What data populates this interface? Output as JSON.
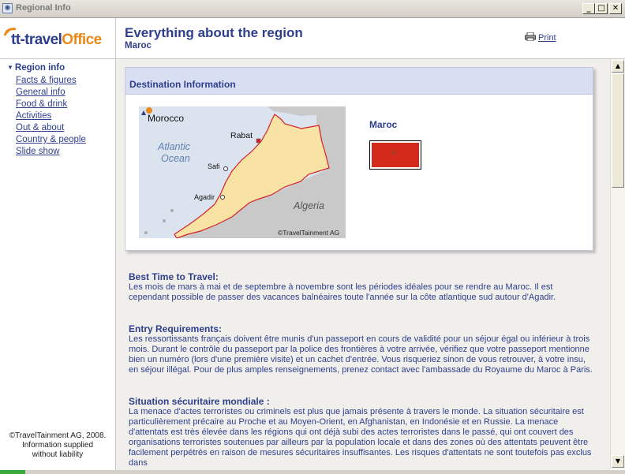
{
  "window": {
    "title": "Regional Info",
    "app_icon": "globe-window-icon",
    "controls": {
      "minimize": "minimize-icon",
      "maximize": "maximize-icon",
      "close": "close-icon"
    }
  },
  "sidebar": {
    "logo": {
      "prefix": "tt-travel",
      "suffix": "Office"
    },
    "section_title": "Region info",
    "items": [
      {
        "label": "Facts & figures"
      },
      {
        "label": "General info"
      },
      {
        "label": "Food & drink"
      },
      {
        "label": "Activities"
      },
      {
        "label": "Out & about"
      },
      {
        "label": "Country & people"
      },
      {
        "label": "Slide show"
      }
    ],
    "footer": [
      "©TravelTainment AG, 2008.",
      "Information supplied",
      "without liability"
    ]
  },
  "header": {
    "title": "Everything about the region",
    "subtitle": "Maroc",
    "print_label": "Print",
    "print_icon": "printer-icon"
  },
  "destination": {
    "heading": "Destination Information",
    "country": "Maroc",
    "flag_colors": {
      "field": "#d42a1c",
      "star": "#0a7a3a"
    },
    "map": {
      "title": "Morocco",
      "ocean": [
        "Atlantic",
        "Ocean"
      ],
      "cities": [
        "Rabat",
        "Safi",
        "Agadir"
      ],
      "neighbor": "Algeria",
      "credit": "©TravelTainment AG",
      "colors": {
        "sea": "#dbe4ee",
        "land": "#f9e3a4",
        "neighbor": "#c9c9c9",
        "border": "#d4202a"
      }
    }
  },
  "sections": [
    {
      "heading": "Best Time to Travel:",
      "text": "Les mois de mars à mai et de septembre à novembre sont les périodes idéales pour se rendre au Maroc. Il est cependant possible de passer des vacances balnéaires toute l'année sur la côte atlantique sud autour d'Agadir."
    },
    {
      "heading": "Entry Requirements:",
      "text": "Les ressortissants français doivent être munis d'un passeport en cours de validité pour un séjour égal ou inférieur à trois mois. Durant le contrôle du passeport par la police des frontières à votre arrivée, vérifiez que votre passeport mentionne bien un numéro (lors d'une première visite) et un cachet d'entrée. Vous risqueriez sinon de vous retrouver, à votre insu, en séjour illégal. Pour de plus amples renseignements, prenez contact avec l'ambassade du Royaume du Maroc à Paris."
    },
    {
      "heading": "Situation sécuritaire mondiale :",
      "text": "La menace d'actes terroristes ou criminels est plus que jamais présente à travers le monde. La situation sécuritaire est particulièrement précaire au Proche et au Moyen-Orient, en Afghanistan, en Indonésie et en Russie. La menace d'attentats est très élevée dans les régions qui ont déjà subi des actes terroristes dans le passé, qui ont couvert des organisations terroristes soutenues par ailleurs par la population locale et dans des zones où des attentats peuvent être facilement perpétrés en raison de mesures sécuritaires insuffisantes. Les risques d'attentats ne sont toutefois pas exclus dans"
    }
  ],
  "scrollbar": {
    "thumb_fraction": 0.3
  }
}
